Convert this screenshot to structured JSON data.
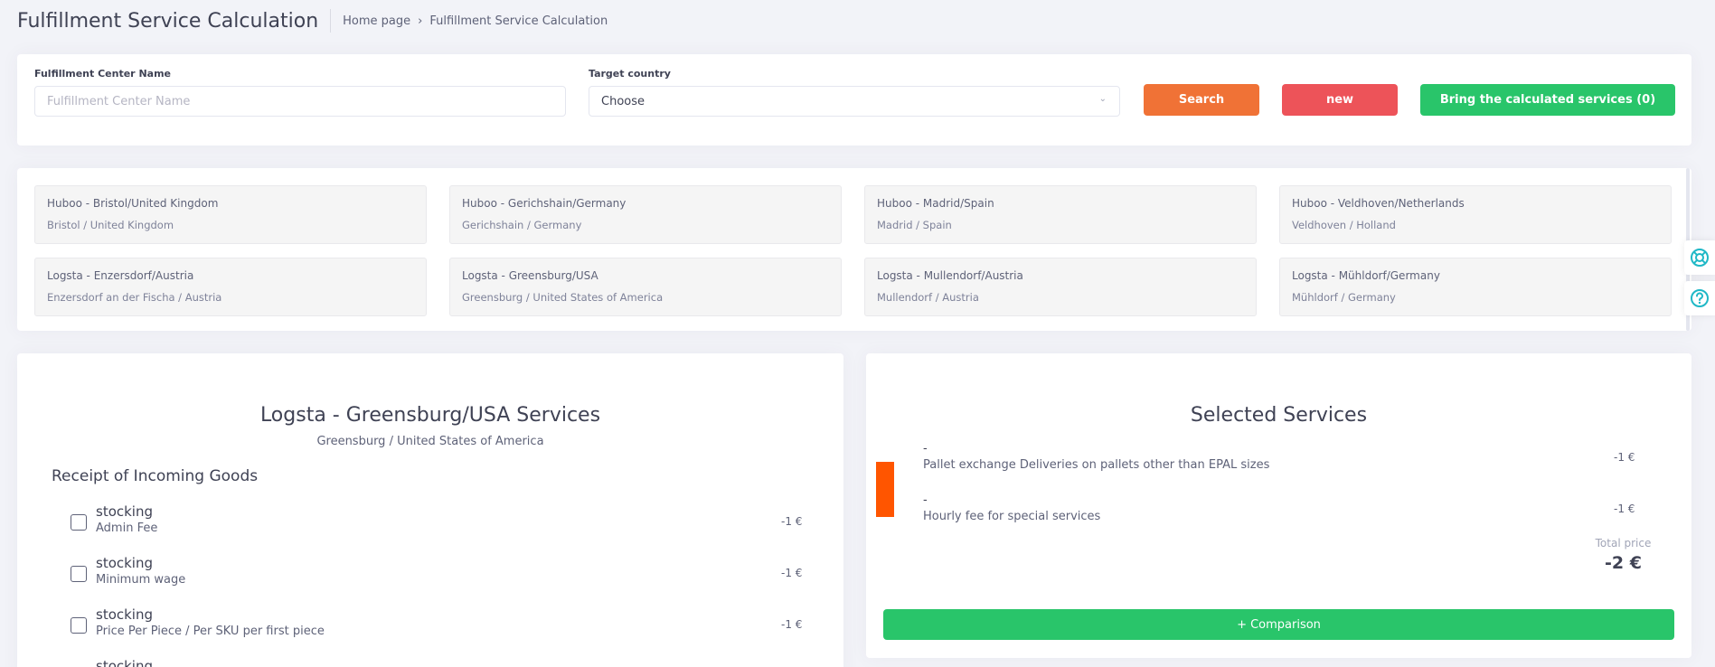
{
  "header": {
    "title": "Fulfillment Service Calculation",
    "breadcrumb": [
      "Home page",
      "Fulfillment Service Calculation"
    ]
  },
  "filters": {
    "name_label": "Fulfillment Center Name",
    "name_placeholder": "Fulfillment Center Name",
    "country_label": "Target country",
    "country_value": "Choose",
    "search_label": "Search",
    "new_label": "new",
    "bring_label": "Bring the calculated services (0)"
  },
  "centers": [
    {
      "name": "Huboo - Bristol/United Kingdom",
      "location": "Bristol / United Kingdom"
    },
    {
      "name": "Huboo - Gerichshain/Germany",
      "location": "Gerichshain / Germany"
    },
    {
      "name": "Huboo - Madrid/Spain",
      "location": "Madrid / Spain"
    },
    {
      "name": "Huboo - Veldhoven/Netherlands",
      "location": "Veldhoven / Holland"
    },
    {
      "name": "Logsta - Enzersdorf/Austria",
      "location": "Enzersdorf an der Fischa / Austria"
    },
    {
      "name": "Logsta - Greensburg/USA",
      "location": "Greensburg / United States of America"
    },
    {
      "name": "Logsta - Mullendorf/Austria",
      "location": "Mullendorf / Austria"
    },
    {
      "name": "Logsta - Mühldorf/Germany",
      "location": "Mühldorf / Germany"
    }
  ],
  "services": {
    "title": "Logsta - Greensburg/USA Services",
    "subtitle": "Greensburg / United States of America",
    "section": "Receipt of Incoming Goods",
    "rows": [
      {
        "name": "stocking",
        "desc": "Admin Fee",
        "price": "-1 €"
      },
      {
        "name": "stocking",
        "desc": "Minimum wage",
        "price": "-1 €"
      },
      {
        "name": "stocking",
        "desc": "Price Per Piece / Per SKU per first piece",
        "price": "-1 €"
      },
      {
        "name": "stocking",
        "desc": "",
        "price": ""
      }
    ]
  },
  "selected": {
    "title": "Selected Services",
    "items": [
      {
        "dash": "-",
        "name": "Pallet exchange Deliveries on pallets other than EPAL sizes",
        "price": "-1 €"
      },
      {
        "dash": "-",
        "name": "Hourly fee for special services",
        "price": "-1 €"
      }
    ],
    "total_label": "Total price",
    "total_value": "-2 €",
    "compare_label": "+ Comparison",
    "accent_color": "#ff5500"
  },
  "side_icons": [
    "lifebuoy-icon",
    "help-icon"
  ]
}
